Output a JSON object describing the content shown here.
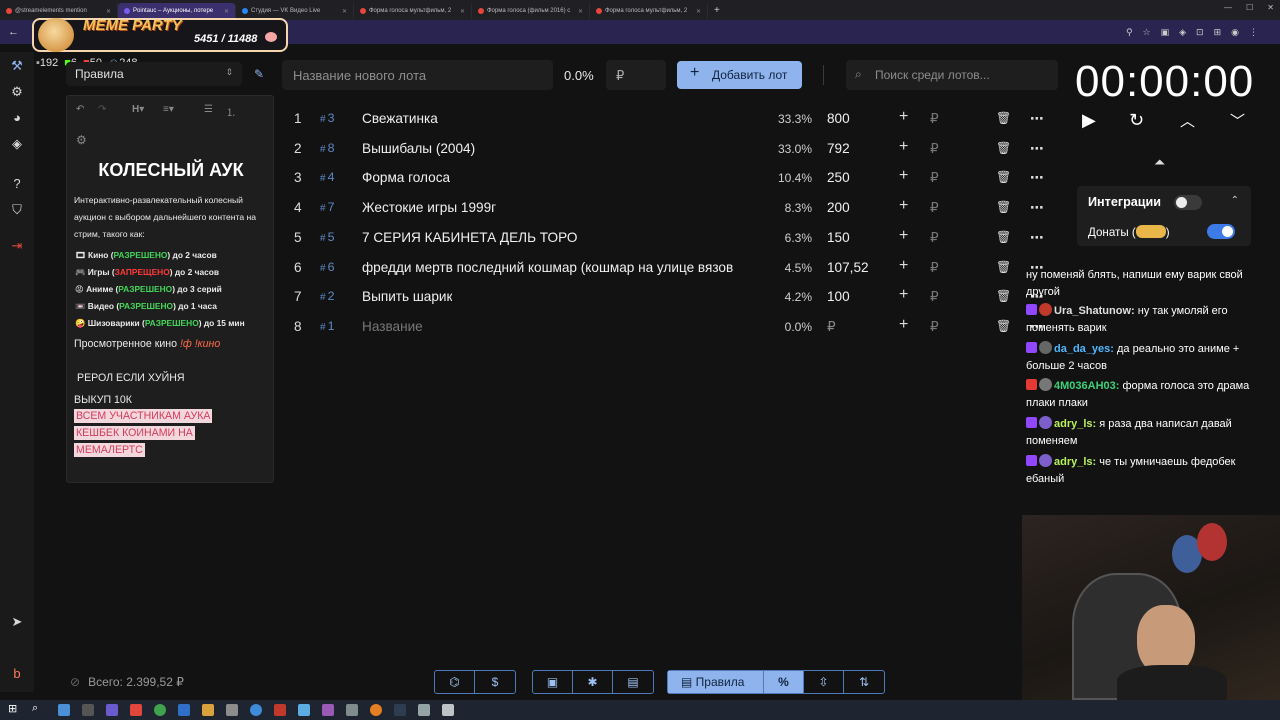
{
  "browser": {
    "tabs": [
      {
        "label": "@streamelements mention"
      },
      {
        "label": "Pointauc – Аукционы, лотере"
      },
      {
        "label": "Студия — VK Видео Live"
      },
      {
        "label": "Форма голоса мультфильм, 2"
      },
      {
        "label": "Форма голоса (фильм 2016) с"
      },
      {
        "label": "Форма голоса мультфильм, 2"
      }
    ]
  },
  "overlay": {
    "title": "MEME PARTY",
    "count": "5451 / 11488"
  },
  "stats": {
    "chat": "192",
    "ban": "6",
    "vk": "50",
    "users": "248"
  },
  "rules": {
    "header": "Правила",
    "heading_btn": "H",
    "title": "КОЛЕСНЫЙ АУК",
    "intro": "Интерактивно-развлекательный колесный аукцион с выбором дальнейшего контента на стрим, такого как:",
    "items": [
      {
        "pre": "Кино (",
        "status": "РАЗРЕШЕНО",
        "post": ") до 2 часов"
      },
      {
        "pre": "Игры (",
        "status": "ЗАПРЕЩЕНО",
        "post": ") до 2 часов"
      },
      {
        "pre": "Аниме (",
        "status": "РАЗРЕШЕНО",
        "post": ") до 3 серий"
      },
      {
        "pre": "Видео (",
        "status": "РАЗРЕШЕНО",
        "post": ") до 1 часа"
      },
      {
        "pre": "Шизоварики (",
        "status": "РАЗРЕШЕНО",
        "post": ") до 15 мин"
      }
    ],
    "watched_label": "Просмотренное кино",
    "watched_cmd": "!ф !кино",
    "reroll": "РЕРОЛ ЕСЛИ ХУЙНЯ",
    "buyout": "ВЫКУП 10К",
    "cashback": [
      "ВСЕМ УЧАСТНИКАМ АУКА",
      "КЕШБЕК КОИНАМИ НА",
      "МЕМАЛЕРТС"
    ]
  },
  "toolbar": {
    "lot_placeholder": "Название нового лота",
    "lot_pct": "0.0%",
    "currency": "₽",
    "add_label": "Добавить лот",
    "search_placeholder": "Поиск среди лотов..."
  },
  "lots": [
    {
      "num": "1",
      "id": "3",
      "name": "Свежатинка",
      "pct": "33.3%",
      "amount": "800"
    },
    {
      "num": "2",
      "id": "8",
      "name": "Вышибалы (2004)",
      "pct": "33.0%",
      "amount": "792"
    },
    {
      "num": "3",
      "id": "4",
      "name": "Форма голоса",
      "pct": "10.4%",
      "amount": "250"
    },
    {
      "num": "4",
      "id": "7",
      "name": "Жестокие игры 1999г",
      "pct": "8.3%",
      "amount": "200"
    },
    {
      "num": "5",
      "id": "5",
      "name": "7 СЕРИЯ КАБИНЕТА ДЕЛЬ ТОРО",
      "pct": "6.3%",
      "amount": "150"
    },
    {
      "num": "6",
      "id": "6",
      "name": "фредди мертв последний кошмар (кошмар на улице вязов",
      "pct": "4.5%",
      "amount": "107,52"
    },
    {
      "num": "7",
      "id": "2",
      "name": "Выпить шарик",
      "pct": "4.2%",
      "amount": "100"
    },
    {
      "num": "8",
      "id": "1",
      "name": "Название",
      "pct": "0.0%",
      "amount": "₽"
    }
  ],
  "timer": {
    "value": "00:00:00"
  },
  "integrations": {
    "title": "Интеграции",
    "donate_label": "Донаты (",
    "donate_after": ")"
  },
  "chat": [
    {
      "nick": "",
      "text": "ну поменяй блять, напиши ему варик свой другой",
      "color": "#ffffff"
    },
    {
      "nick": "Ura_Shatunow:",
      "text": "ну так умоляй его поменять варик",
      "color": "#e0e0e0"
    },
    {
      "nick": "da_da_yes:",
      "text": "да реально это аниме + больше 2 часов",
      "color": "#4db8ff"
    },
    {
      "nick": "4M036AH03:",
      "text": "форма голоса это драма плаки плаки",
      "color": "#3cd078"
    },
    {
      "nick": "adry_ls:",
      "text": "я раза два написал давай поменяем",
      "color": "#b7f25a"
    },
    {
      "nick": "adry_ls:",
      "text": "че ты умничаешь федобек ебаный",
      "color": "#b7f25a"
    }
  ],
  "footer": {
    "total": "Всего: 2.399,52 ₽",
    "rules_tab": "Правила",
    "percent": "%"
  },
  "colors": {
    "accent": "#8fb4ed",
    "id": "#5d88c6",
    "bg": "#121212",
    "panel": "#1e1e1e",
    "allowed": "#43d65a",
    "forbidden": "#ff3a3a"
  }
}
